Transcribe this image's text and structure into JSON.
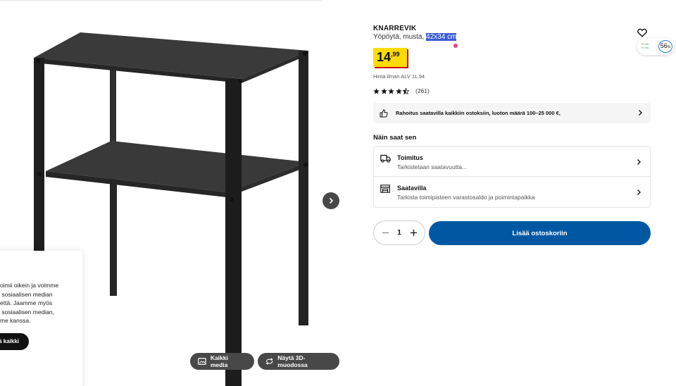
{
  "product": {
    "brand": "KNARREVIK",
    "description_prefix": "Yöpöytä, musta, ",
    "description_size": "42x34 cm",
    "price_integer": "14",
    "price_decimals": ",99",
    "vat_note": "Hinta ilman ALV 11,94",
    "rating": {
      "stars": 4.5,
      "count": "(261)"
    }
  },
  "widget": {
    "percent": "56",
    "percent_suffix": "%",
    "mini_line1": "+0 h/s",
    "mini_line2": "+0 h/s"
  },
  "finance_banner": {
    "text": "Rahoitus saatavilla kaikkiin ostoksiin, luoton määrä 100–25 000 €,"
  },
  "fulfilment": {
    "heading": "Näin saat sen",
    "options": [
      {
        "title": "Toimitus",
        "subtitle": "Tarkistetaan saatavuutta..."
      },
      {
        "title": "Saatavilla",
        "subtitle": "Tarkista toimipisteen varastosaldo ja poimintapaikka"
      }
    ]
  },
  "cart": {
    "quantity": "1",
    "add_label": "Lisää ostoskoriin"
  },
  "gallery": {
    "media_label": "Kaikki media",
    "view3d_label": "Näytä 3D-muodossa"
  },
  "cookie": {
    "text_lines": "oimii oikein ja voimme\n sosiaalisen median\nettä. Jaamme myös\n sosiaalisen median,\nme kanssa.",
    "accept_label": "ä kaikki"
  },
  "colors": {
    "accent_blue": "#0058a3",
    "price_yellow": "#ffdb00",
    "price_red": "#cc0008",
    "highlight": "#3b5bd6"
  }
}
